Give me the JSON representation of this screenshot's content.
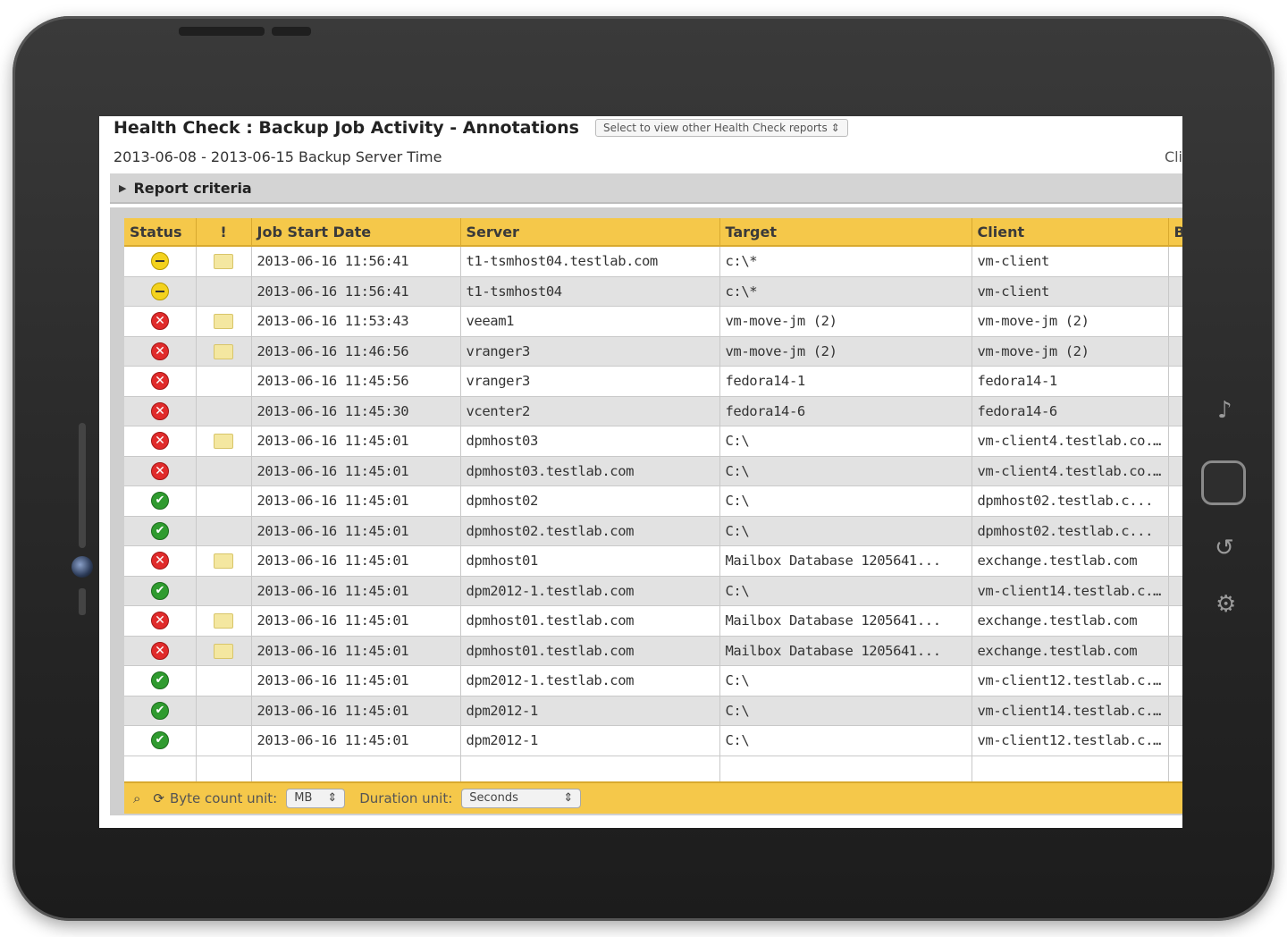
{
  "report": {
    "title": "Health Check : Backup Job Activity - Annotations",
    "select_label": "Select to view other Health Check reports",
    "date_range": "2013-06-08 - 2013-06-15 Backup Server Time",
    "click_text": "Cli",
    "criteria_label": "Report criteria"
  },
  "table": {
    "columns": [
      "Status",
      "!",
      "Job Start Date",
      "Server",
      "Target",
      "Client",
      "B"
    ],
    "rows": [
      {
        "status": "warn",
        "note": true,
        "date": "2013-06-16 11:56:41",
        "server": "t1-tsmhost04.testlab.com",
        "target": "c:\\*",
        "client": "vm-client"
      },
      {
        "status": "warn",
        "note": false,
        "date": "2013-06-16 11:56:41",
        "server": "t1-tsmhost04",
        "target": "c:\\*",
        "client": "vm-client"
      },
      {
        "status": "error",
        "note": true,
        "date": "2013-06-16 11:53:43",
        "server": "veeam1",
        "target": "vm-move-jm (2)",
        "client": "vm-move-jm (2)"
      },
      {
        "status": "error",
        "note": true,
        "date": "2013-06-16 11:46:56",
        "server": "vranger3",
        "target": "vm-move-jm (2)",
        "client": "vm-move-jm (2)"
      },
      {
        "status": "error",
        "note": false,
        "date": "2013-06-16 11:45:56",
        "server": "vranger3",
        "target": "fedora14-1",
        "client": "fedora14-1"
      },
      {
        "status": "error",
        "note": false,
        "date": "2013-06-16 11:45:30",
        "server": "vcenter2",
        "target": "fedora14-6",
        "client": "fedora14-6"
      },
      {
        "status": "error",
        "note": true,
        "date": "2013-06-16 11:45:01",
        "server": "dpmhost03",
        "target": "C:\\",
        "client": "vm-client4.testlab.co..."
      },
      {
        "status": "error",
        "note": false,
        "date": "2013-06-16 11:45:01",
        "server": "dpmhost03.testlab.com",
        "target": "C:\\",
        "client": "vm-client4.testlab.co..."
      },
      {
        "status": "ok",
        "note": false,
        "date": "2013-06-16 11:45:01",
        "server": "dpmhost02",
        "target": "C:\\",
        "client": "dpmhost02.testlab.c..."
      },
      {
        "status": "ok",
        "note": false,
        "date": "2013-06-16 11:45:01",
        "server": "dpmhost02.testlab.com",
        "target": "C:\\",
        "client": "dpmhost02.testlab.c..."
      },
      {
        "status": "error",
        "note": true,
        "date": "2013-06-16 11:45:01",
        "server": "dpmhost01",
        "target": "Mailbox Database 1205641...",
        "client": "exchange.testlab.com"
      },
      {
        "status": "ok",
        "note": false,
        "date": "2013-06-16 11:45:01",
        "server": "dpm2012-1.testlab.com",
        "target": "C:\\",
        "client": "vm-client14.testlab.c..."
      },
      {
        "status": "error",
        "note": true,
        "date": "2013-06-16 11:45:01",
        "server": "dpmhost01.testlab.com",
        "target": "Mailbox Database 1205641...",
        "client": "exchange.testlab.com"
      },
      {
        "status": "error",
        "note": true,
        "date": "2013-06-16 11:45:01",
        "server": "dpmhost01.testlab.com",
        "target": "Mailbox Database 1205641...",
        "client": "exchange.testlab.com"
      },
      {
        "status": "ok",
        "note": false,
        "date": "2013-06-16 11:45:01",
        "server": "dpm2012-1.testlab.com",
        "target": "C:\\",
        "client": "vm-client12.testlab.c..."
      },
      {
        "status": "ok",
        "note": false,
        "date": "2013-06-16 11:45:01",
        "server": "dpm2012-1",
        "target": "C:\\",
        "client": "vm-client14.testlab.c..."
      },
      {
        "status": "ok",
        "note": false,
        "date": "2013-06-16 11:45:01",
        "server": "dpm2012-1",
        "target": "C:\\",
        "client": "vm-client12.testlab.c..."
      }
    ]
  },
  "toolbar": {
    "byte_label": "Byte count unit:",
    "byte_value": "MB",
    "duration_label": "Duration unit:",
    "duration_value": "Seconds"
  },
  "colors": {
    "header_yellow": "#f5c84a",
    "status_ok": "#2f9b2f",
    "status_error": "#e02b2b",
    "status_warn": "#f3d21e"
  },
  "icons": {
    "status_ok": "check-circle-icon",
    "status_error": "x-circle-icon",
    "status_warn": "minus-circle-icon",
    "note": "note-icon"
  }
}
